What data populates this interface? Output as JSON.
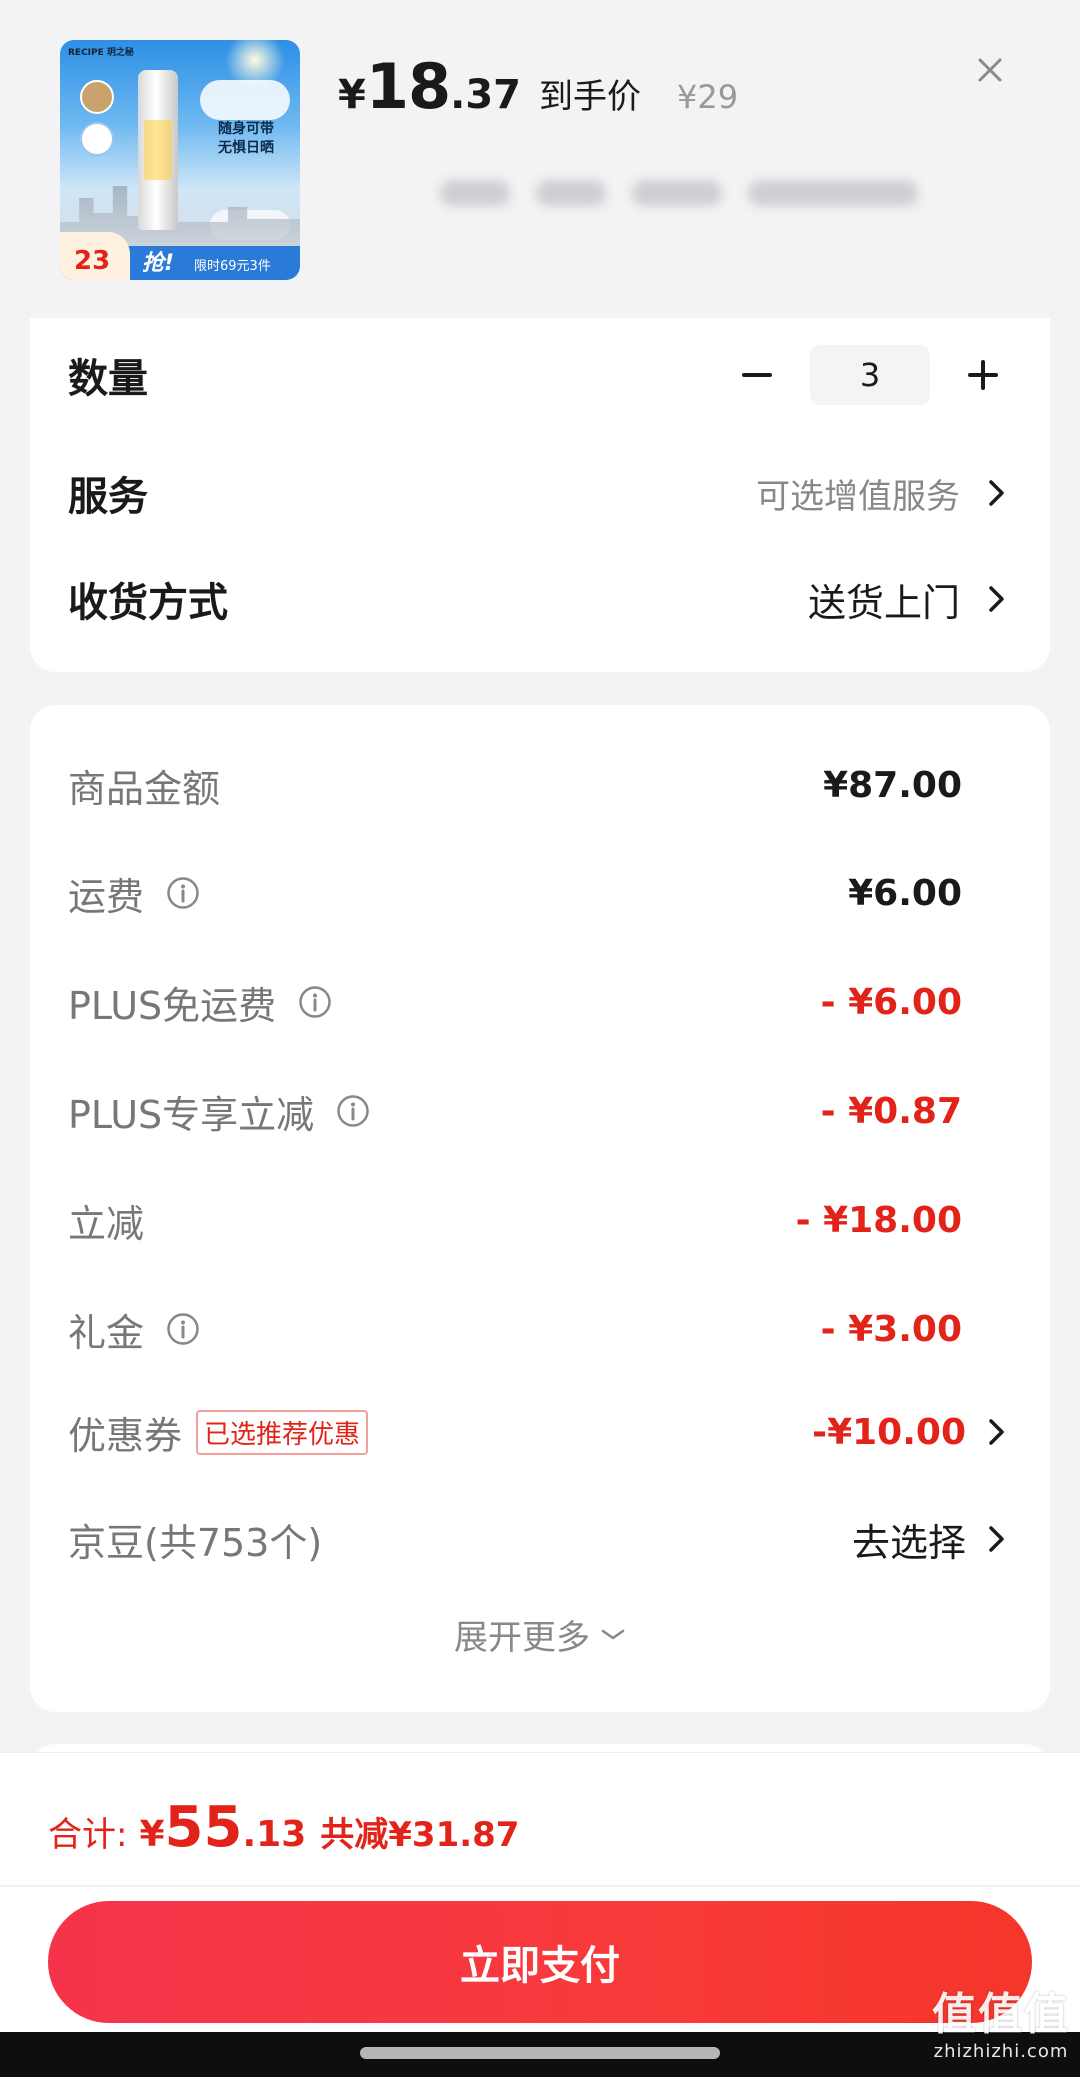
{
  "header": {
    "price_yen": "¥",
    "price_int": "18",
    "price_dec": ".37",
    "price_label": "到手价",
    "original_price": "¥29",
    "thumbnail": {
      "brand": "RECIPE 玥之秘",
      "slogan_line1": "随身可带",
      "slogan_line2": "无惧日晒",
      "badge_price": "23",
      "grab_label": "抢!",
      "limit_text": "限时69元3件"
    }
  },
  "options": {
    "quantity_label": "数量",
    "quantity_value": "3",
    "service_label": "服务",
    "service_value": "可选增值服务",
    "delivery_label": "收货方式",
    "delivery_value": "送货上门"
  },
  "fees": {
    "goods_amount_label": "商品金额",
    "goods_amount_value": "¥87.00",
    "shipping_label": "运费",
    "shipping_value": "¥6.00",
    "plus_free_shipping_label": "PLUS免运费",
    "plus_free_shipping_value": "- ¥6.00",
    "plus_discount_label": "PLUS专享立减",
    "plus_discount_value": "- ¥0.87",
    "instant_discount_label": "立减",
    "instant_discount_value": "- ¥18.00",
    "gift_money_label": "礼金",
    "gift_money_value": "- ¥3.00",
    "coupon_label": "优惠券",
    "coupon_tag": "已选推荐优惠",
    "coupon_value": "-¥10.00",
    "jingdou_label": "京豆(共753个)",
    "jingdou_value": "去选择",
    "expand_label": "展开更多"
  },
  "footer": {
    "total_label": "合计:",
    "total_yen": "¥",
    "total_int": "55",
    "total_dec": ".13",
    "total_saved": "共减¥31.87",
    "pay_button": "立即支付"
  },
  "watermark": {
    "line1": "值值值",
    "line2": "zhizhizhi.com"
  },
  "colors": {
    "accent_red": "#e2231a",
    "pay_button": "#f5344b",
    "background": "#f3f3f5"
  }
}
